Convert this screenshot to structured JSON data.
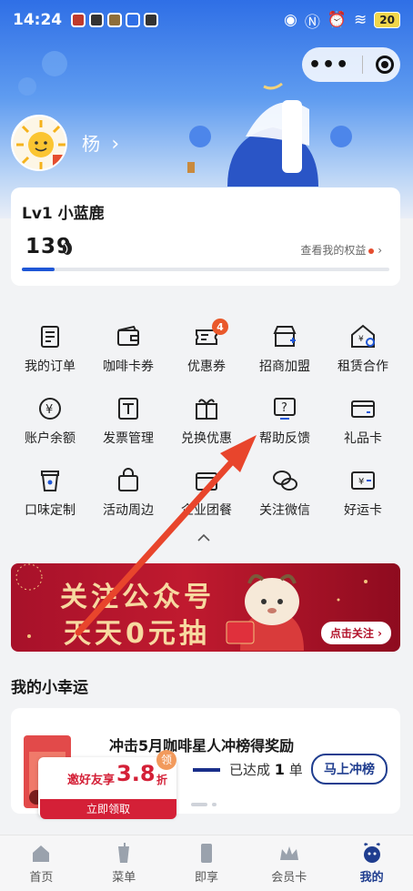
{
  "status_bar": {
    "time": "14:24",
    "battery": "20"
  },
  "profile": {
    "name": "杨",
    "chevron": "›"
  },
  "level_card": {
    "level": "Lv1 小蓝鹿",
    "points": "139",
    "benefits_label": "查看我的权益",
    "progress_fraction": 0.09
  },
  "menu": [
    {
      "label": "我的订单",
      "icon": "order-list-icon"
    },
    {
      "label": "咖啡卡券",
      "icon": "coffee-card-icon"
    },
    {
      "label": "优惠券",
      "icon": "coupon-icon",
      "badge": "4"
    },
    {
      "label": "招商加盟",
      "icon": "franchise-store-icon"
    },
    {
      "label": "租赁合作",
      "icon": "rental-house-icon"
    },
    {
      "label": "账户余额",
      "icon": "yuan-balance-icon"
    },
    {
      "label": "发票管理",
      "icon": "invoice-icon"
    },
    {
      "label": "兑换优惠",
      "icon": "gift-exchange-icon"
    },
    {
      "label": "帮助反馈",
      "icon": "help-feedback-icon"
    },
    {
      "label": "礼品卡",
      "icon": "gift-card-icon"
    },
    {
      "label": "口味定制",
      "icon": "cup-icon"
    },
    {
      "label": "活动周边",
      "icon": "shopping-bag-icon"
    },
    {
      "label": "企业团餐",
      "icon": "group-meal-icon"
    },
    {
      "label": "关注微信",
      "icon": "wechat-icon"
    },
    {
      "label": "好运卡",
      "icon": "lucky-card-icon"
    }
  ],
  "banner": {
    "line1": "关注公众号",
    "line2": "天天0元抽",
    "button": "点击关注 ›"
  },
  "lucky_section": {
    "title": "我的小幸运"
  },
  "lucky_card": {
    "title": "冲击5月咖啡星人冲榜得奖励",
    "reached_prefix": "已达成",
    "reached_count": "1",
    "reached_suffix": "单",
    "button": "马上冲榜",
    "coupon": {
      "invite": "邀好友享",
      "amount": "3.8",
      "unit": "折",
      "claim": "立即领取",
      "tag": "领"
    }
  },
  "tabs": [
    {
      "label": "首页",
      "icon": "home-icon"
    },
    {
      "label": "菜单",
      "icon": "drink-cup-icon"
    },
    {
      "label": "即享",
      "icon": "phone-icon"
    },
    {
      "label": "会员卡",
      "icon": "crown-icon"
    },
    {
      "label": "我的",
      "icon": "deer-icon",
      "active": true
    }
  ],
  "colors": {
    "brand_blue": "#1f3d8f",
    "accent_red": "#e54d2e",
    "annotation_arrow": "#e8452c"
  }
}
